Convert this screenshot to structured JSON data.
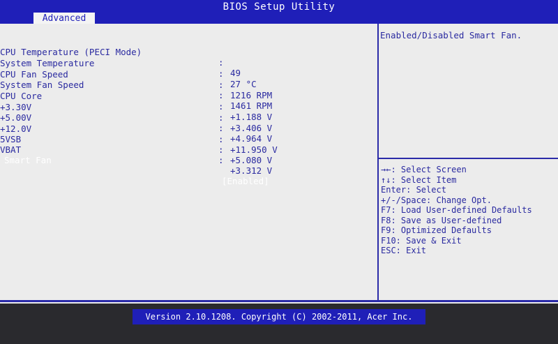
{
  "window": {
    "title": "BIOS Setup Utility"
  },
  "tabs": [
    {
      "label": "Advanced"
    }
  ],
  "items": [
    {
      "label": "CPU Temperature (PECI Mode)",
      "sep": ":",
      "value": "49"
    },
    {
      "label": "System Temperature",
      "sep": ":",
      "value": "27 °C"
    },
    {
      "label": "CPU Fan Speed",
      "sep": ":",
      "value": "1216 RPM"
    },
    {
      "label": "System Fan Speed",
      "sep": ":",
      "value": "1461 RPM"
    },
    {
      "label": "CPU Core",
      "sep": ":",
      "value": "+1.188 V"
    },
    {
      "label": "+3.30V",
      "sep": ":",
      "value": "+3.406 V"
    },
    {
      "label": "+5.00V",
      "sep": ":",
      "value": "+4.964 V"
    },
    {
      "label": "+12.0V",
      "sep": ":",
      "value": "+11.950 V"
    },
    {
      "label": "5VSB",
      "sep": ":",
      "value": "+5.080 V"
    },
    {
      "label": "VBAT",
      "sep": ":",
      "value": "+3.312 V"
    },
    {
      "label": "Smart Fan",
      "sep": "",
      "value": "[Enabled]"
    }
  ],
  "help": {
    "text": "Enabled/Disabled Smart Fan."
  },
  "keys": [
    "→←: Select Screen",
    "↑↓: Select Item",
    "Enter: Select",
    "+/-/Space: Change Opt.",
    "F7: Load User-defined Defaults",
    "F8: Save as User-defined",
    "F9: Optimized Defaults",
    "F10: Save & Exit",
    "ESC: Exit"
  ],
  "footer": {
    "text": "Version 2.10.1208. Copyright (C) 2002-2011, Acer Inc."
  }
}
